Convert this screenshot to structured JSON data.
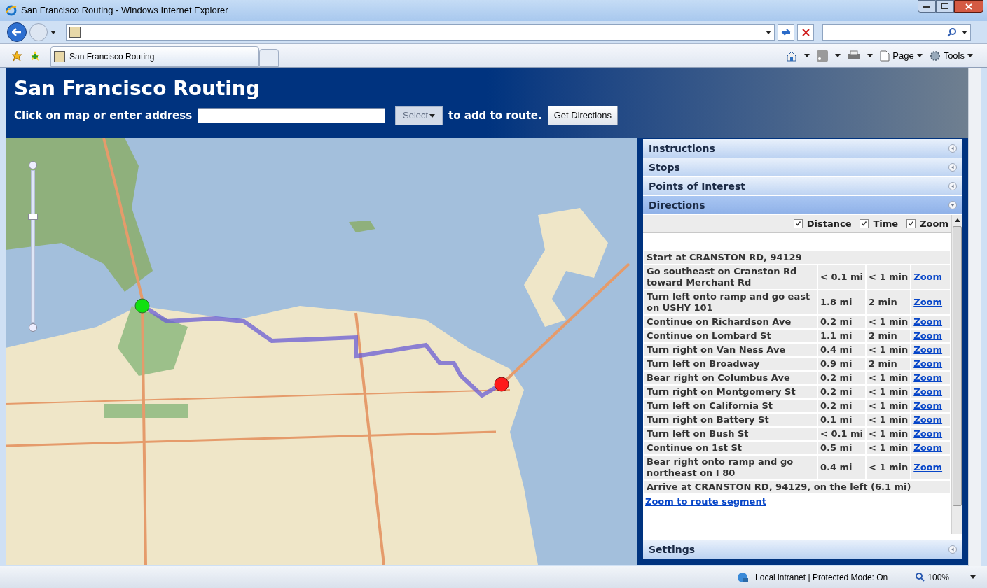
{
  "window": {
    "title": "San Francisco Routing - Windows Internet Explorer"
  },
  "browser": {
    "tab_title": "San Francisco Routing",
    "toolbar": [
      {
        "label": "Page"
      },
      {
        "label": "Tools"
      }
    ]
  },
  "page": {
    "title": "San Francisco Routing",
    "prompt": "Click on map or enter address",
    "select": {
      "label": "Select",
      "disabled": true
    },
    "suffix": "to add to route.",
    "button": "Get Directions"
  },
  "map": {
    "zoom_slider": {
      "level": 0.71
    }
  },
  "panel": {
    "sections": [
      {
        "title": "Instructions",
        "expanded": false
      },
      {
        "title": "Stops",
        "expanded": false
      },
      {
        "title": "Points of Interest",
        "expanded": false
      },
      {
        "title": "Directions",
        "expanded": true
      }
    ],
    "options": [
      {
        "label": "Distance",
        "checked": true
      },
      {
        "label": "Time",
        "checked": true
      },
      {
        "label": "Zoom",
        "checked": true
      }
    ],
    "start": "Start at CRANSTON RD, 94129",
    "steps": [
      {
        "text": "Go southeast on Cranston Rd toward Merchant Rd",
        "distance": "< 0.1 mi",
        "time": "< 1 min",
        "link": "Zoom"
      },
      {
        "text": "Turn left onto ramp and go east on USHY 101",
        "distance": "1.8 mi",
        "time": "2 min",
        "link": "Zoom"
      },
      {
        "text": "Continue on Richardson Ave",
        "distance": "0.2 mi",
        "time": "< 1 min",
        "link": "Zoom"
      },
      {
        "text": "Continue on Lombard St",
        "distance": "1.1 mi",
        "time": "2 min",
        "link": "Zoom"
      },
      {
        "text": "Turn right on Van Ness Ave",
        "distance": "0.4 mi",
        "time": "< 1 min",
        "link": "Zoom"
      },
      {
        "text": "Turn left on Broadway",
        "distance": "0.9 mi",
        "time": "2 min",
        "link": "Zoom"
      },
      {
        "text": "Bear right on Columbus Ave",
        "distance": "0.2 mi",
        "time": "< 1 min",
        "link": "Zoom"
      },
      {
        "text": "Turn right on Montgomery St",
        "distance": "0.2 mi",
        "time": "< 1 min",
        "link": "Zoom"
      },
      {
        "text": "Turn left on California St",
        "distance": "0.2 mi",
        "time": "< 1 min",
        "link": "Zoom"
      },
      {
        "text": "Turn right on Battery St",
        "distance": "0.1 mi",
        "time": "< 1 min",
        "link": "Zoom"
      },
      {
        "text": "Turn left on Bush St",
        "distance": "< 0.1 mi",
        "time": "< 1 min",
        "link": "Zoom"
      },
      {
        "text": "Continue on 1st St",
        "distance": "0.5 mi",
        "time": "< 1 min",
        "link": "Zoom"
      },
      {
        "text": "Bear right onto ramp and go northeast on I 80",
        "distance": "0.4 mi",
        "time": "< 1 min",
        "link": "Zoom"
      }
    ],
    "arrive": "Arrive at CRANSTON RD, 94129, on the left (6.1 mi)",
    "segment_link": "Zoom to route segment",
    "footer_section": {
      "title": "Settings",
      "expanded": false
    }
  },
  "status_bar": {
    "zone": "Local intranet | Protected Mode: On",
    "zoom": "100%"
  }
}
